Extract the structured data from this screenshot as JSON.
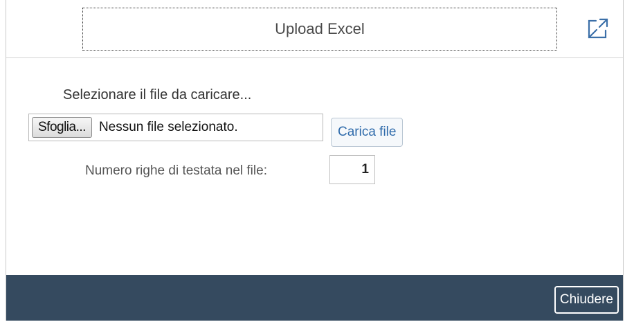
{
  "dialog": {
    "title": "Upload Excel",
    "expand_icon": "expand-diagonal-icon"
  },
  "content": {
    "prompt": "Selezionare il file da caricare...",
    "browse_label": "Sfoglia...",
    "file_status": "Nessun file selezionato.",
    "upload_label": "Carica file",
    "header_rows_label": "Numero righe di testata nel file:",
    "header_rows_value": "1"
  },
  "footer": {
    "close_label": "Chiudere"
  },
  "colors": {
    "footer_bg": "#354a5f",
    "link_text": "#2f6bab"
  }
}
